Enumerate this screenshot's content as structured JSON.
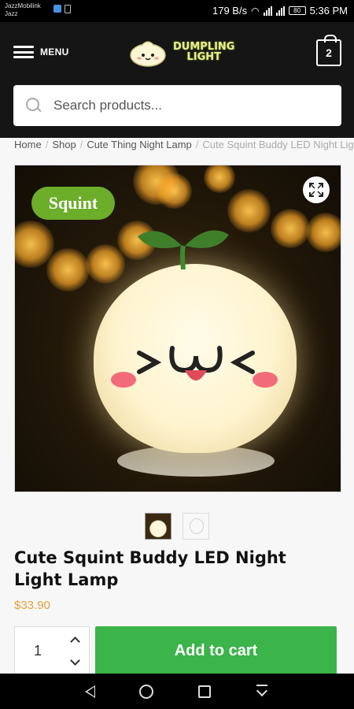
{
  "status_bar": {
    "carrier_line1": "JazzMobilink",
    "carrier_line2": "Jazz",
    "speed": "179 B/s",
    "battery": "80",
    "time": "5:36 PM"
  },
  "header": {
    "menu_label": "MENU",
    "logo_line1": "DUMPLING",
    "logo_line2": "LIGHT",
    "cart_count": "2",
    "search_placeholder": "Search products..."
  },
  "breadcrumb": {
    "items": [
      "Home",
      "Shop",
      "Cute Thing Night Lamp"
    ],
    "current": "Cute Squint Buddy LED Night Light Lamp"
  },
  "product": {
    "badge": "Squint",
    "title": "Cute Squint Buddy LED Night Light Lamp",
    "price": "$33.90",
    "quantity": "1",
    "add_to_cart_label": "Add to cart",
    "face_text": ">ω<"
  },
  "icons": {
    "menu": "hamburger-icon",
    "cart": "shopping-bag-icon",
    "search": "search-icon",
    "zoom": "expand-icon",
    "nav": [
      "back-icon",
      "home-icon",
      "recent-apps-icon",
      "notification-pull-icon"
    ]
  },
  "colors": {
    "header_bg": "#151515",
    "badge_green": "#6cad2a",
    "add_to_cart_green": "#3bb44a",
    "price_orange": "#e0a33a"
  }
}
